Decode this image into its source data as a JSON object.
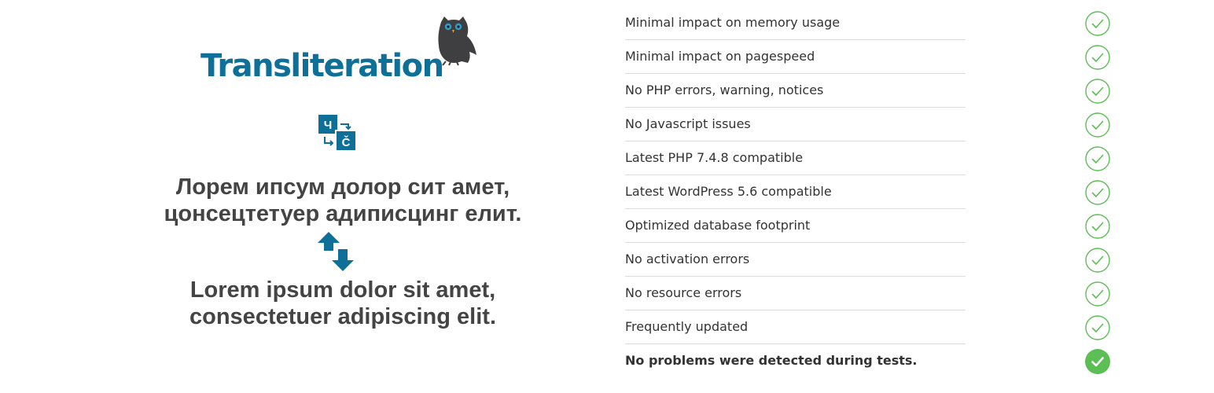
{
  "logo": {
    "wordmark": "Transliteration",
    "owl_icon": "owl-icon"
  },
  "translit_icon": {
    "cyr_letter": "Ч",
    "lat_letter": "Č"
  },
  "cyrillic_text": {
    "line1": "Лорем ипсум долор сит амет,",
    "line2": "цонсецтетуер адиписцинг елит."
  },
  "latin_text": {
    "line1": "Lorem ipsum dolor sit amet,",
    "line2": "consectetuer adipiscing elit."
  },
  "checks": [
    {
      "label": "Minimal impact on memory usage",
      "status": "pass"
    },
    {
      "label": "Minimal impact on pagespeed",
      "status": "pass"
    },
    {
      "label": "No PHP errors, warning, notices",
      "status": "pass"
    },
    {
      "label": "No Javascript issues",
      "status": "pass"
    },
    {
      "label": "Latest PHP 7.4.8 compatible",
      "status": "pass"
    },
    {
      "label": "Latest WordPress 5.6 compatible",
      "status": "pass"
    },
    {
      "label": "Optimized database footprint",
      "status": "pass"
    },
    {
      "label": "No activation errors",
      "status": "pass"
    },
    {
      "label": "No resource errors",
      "status": "pass"
    },
    {
      "label": "Frequently updated",
      "status": "pass"
    }
  ],
  "summary": {
    "label": "No problems were detected during tests.",
    "status": "pass"
  },
  "colors": {
    "brand_blue": "#0e6f99",
    "check_green": "#5cbf55",
    "text_dark": "#444444"
  }
}
